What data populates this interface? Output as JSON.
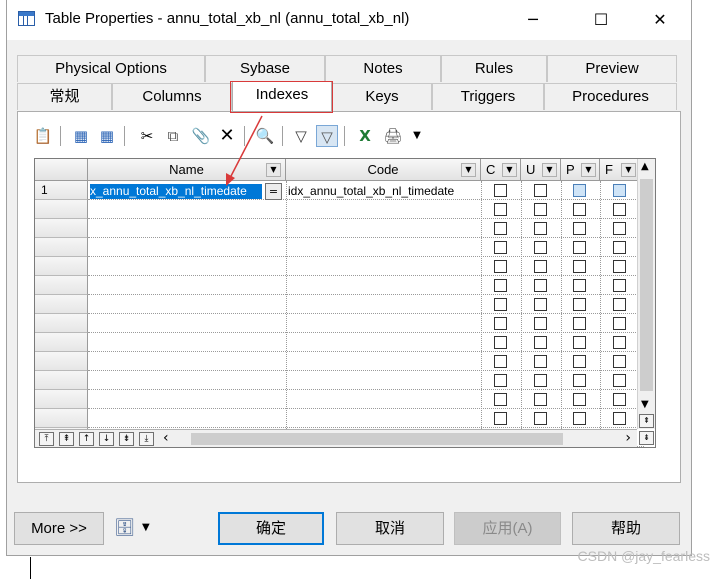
{
  "window": {
    "title": "Table Properties - annu_total_xb_nl (annu_total_xb_nl)",
    "controls": {
      "minimize": "─",
      "maximize": "☐",
      "close": "✕"
    }
  },
  "tabs": {
    "row1": [
      "Physical Options",
      "Sybase",
      "Notes",
      "Rules",
      "Preview"
    ],
    "row2": [
      "常规",
      "Columns",
      "Indexes",
      "Keys",
      "Triggers",
      "Procedures"
    ],
    "active": "Indexes"
  },
  "grid": {
    "columns": {
      "name": "Name",
      "code": "Code",
      "c": "C",
      "u": "U",
      "p": "P",
      "f": "F"
    },
    "rows": [
      {
        "num": "1",
        "name": "x_annu_total_xb_nl_timedate",
        "code": "idx_annu_total_xb_nl_timedate"
      }
    ],
    "eq_label": "=",
    "total_visible_rows": 14
  },
  "navigation": {
    "first": "⤒",
    "prev_page": "⇞",
    "prev": "↑",
    "next": "↓",
    "next_page": "⇟",
    "last": "⤓"
  },
  "scroll": {
    "up": "▲",
    "down": "▼",
    "left": "‹",
    "right": "›"
  },
  "buttons": {
    "more": "More >>",
    "ok": "确定",
    "cancel": "取消",
    "apply": "应用(A)",
    "help": "帮助"
  },
  "watermark": "CSDN @jay_fearless",
  "colors": {
    "selection": "#0078d7",
    "annotation": "#d93a3a",
    "primary_border": "#0078d7"
  }
}
